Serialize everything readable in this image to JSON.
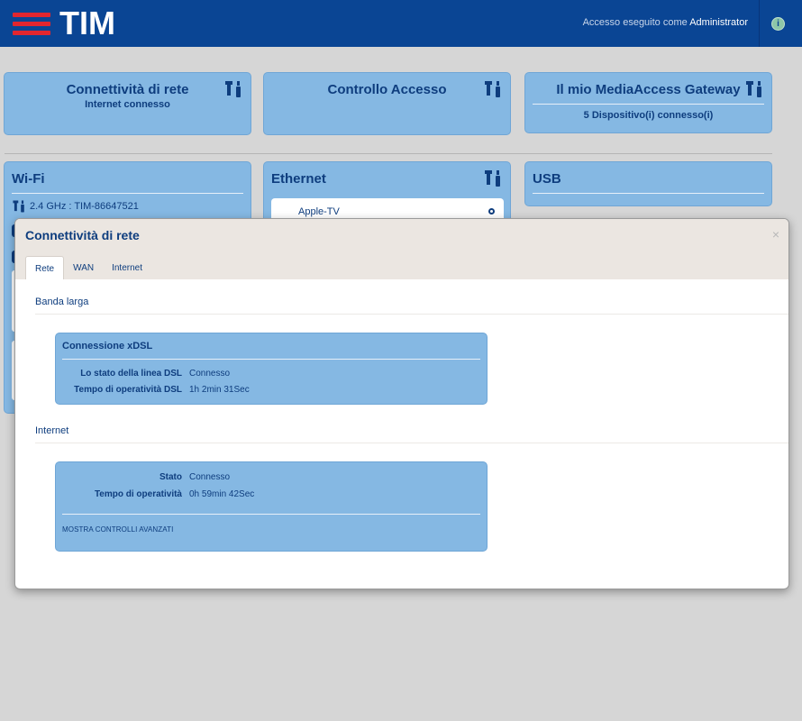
{
  "header": {
    "logo_text": "TIM",
    "login_prefix": "Accesso eseguito come",
    "login_user": "Administrator",
    "info_glyph": "i"
  },
  "cards": {
    "network": {
      "title": "Connettività di rete",
      "subtitle": "Internet connesso"
    },
    "access": {
      "title": "Controllo Accesso"
    },
    "gateway": {
      "title": "Il mio MediaAccess Gateway",
      "subtitle": "5 Dispositivo(i) connesso(i)"
    },
    "wifi": {
      "title": "Wi-Fi",
      "band": "2.4 GHz : TIM-86647521"
    },
    "ethernet": {
      "title": "Ethernet",
      "device": "Apple-TV"
    },
    "usb": {
      "title": "USB"
    }
  },
  "modal": {
    "title": "Connettività di rete",
    "close": "×",
    "tabs": [
      {
        "label": "Rete",
        "active": true
      },
      {
        "label": "WAN",
        "active": false
      },
      {
        "label": "Internet",
        "active": false
      }
    ],
    "sections": {
      "broadband": {
        "title": "Banda larga",
        "panel_title": "Connessione xDSL",
        "rows": [
          {
            "key": "Lo stato della linea DSL",
            "value": "Connesso"
          },
          {
            "key": "Tempo di operatività DSL",
            "value": "1h 2min 31Sec"
          }
        ]
      },
      "internet": {
        "title": "Internet",
        "rows": [
          {
            "key": "Stato",
            "value": "Connesso"
          },
          {
            "key": "Tempo di operatività",
            "value": "0h 59min 42Sec"
          }
        ],
        "advanced_link": "MOSTRA CONTROLLI AVANZATI"
      }
    }
  },
  "colors": {
    "header_bg": "#0a4594",
    "card_bg": "#85b8e3",
    "text_primary": "#0e3d7e",
    "logo_red": "#e2262f",
    "page_bg": "#d6d6d6"
  }
}
